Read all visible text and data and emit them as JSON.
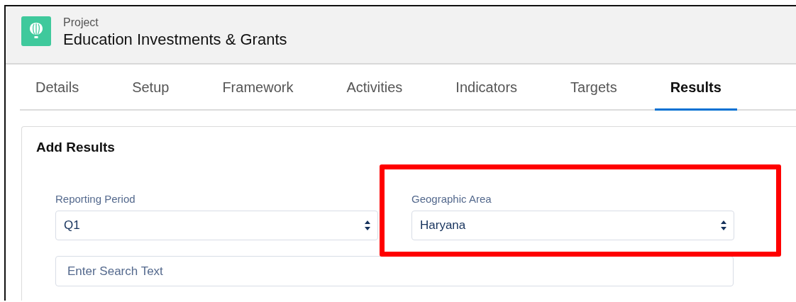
{
  "header": {
    "object_type": "Project",
    "title": "Education Investments & Grants"
  },
  "tabs": [
    {
      "label": "Details",
      "selected": false
    },
    {
      "label": "Setup",
      "selected": false
    },
    {
      "label": "Framework",
      "selected": false
    },
    {
      "label": "Activities",
      "selected": false
    },
    {
      "label": "Indicators",
      "selected": false
    },
    {
      "label": "Targets",
      "selected": false
    },
    {
      "label": "Results",
      "selected": true
    }
  ],
  "card": {
    "title": "Add Results",
    "fields": [
      {
        "label": "Reporting Period",
        "value": "Q1",
        "highlighted": false
      },
      {
        "label": "Geographic Area",
        "value": "Haryana",
        "highlighted": true
      }
    ],
    "search": {
      "placeholder": "Enter Search Text"
    }
  }
}
